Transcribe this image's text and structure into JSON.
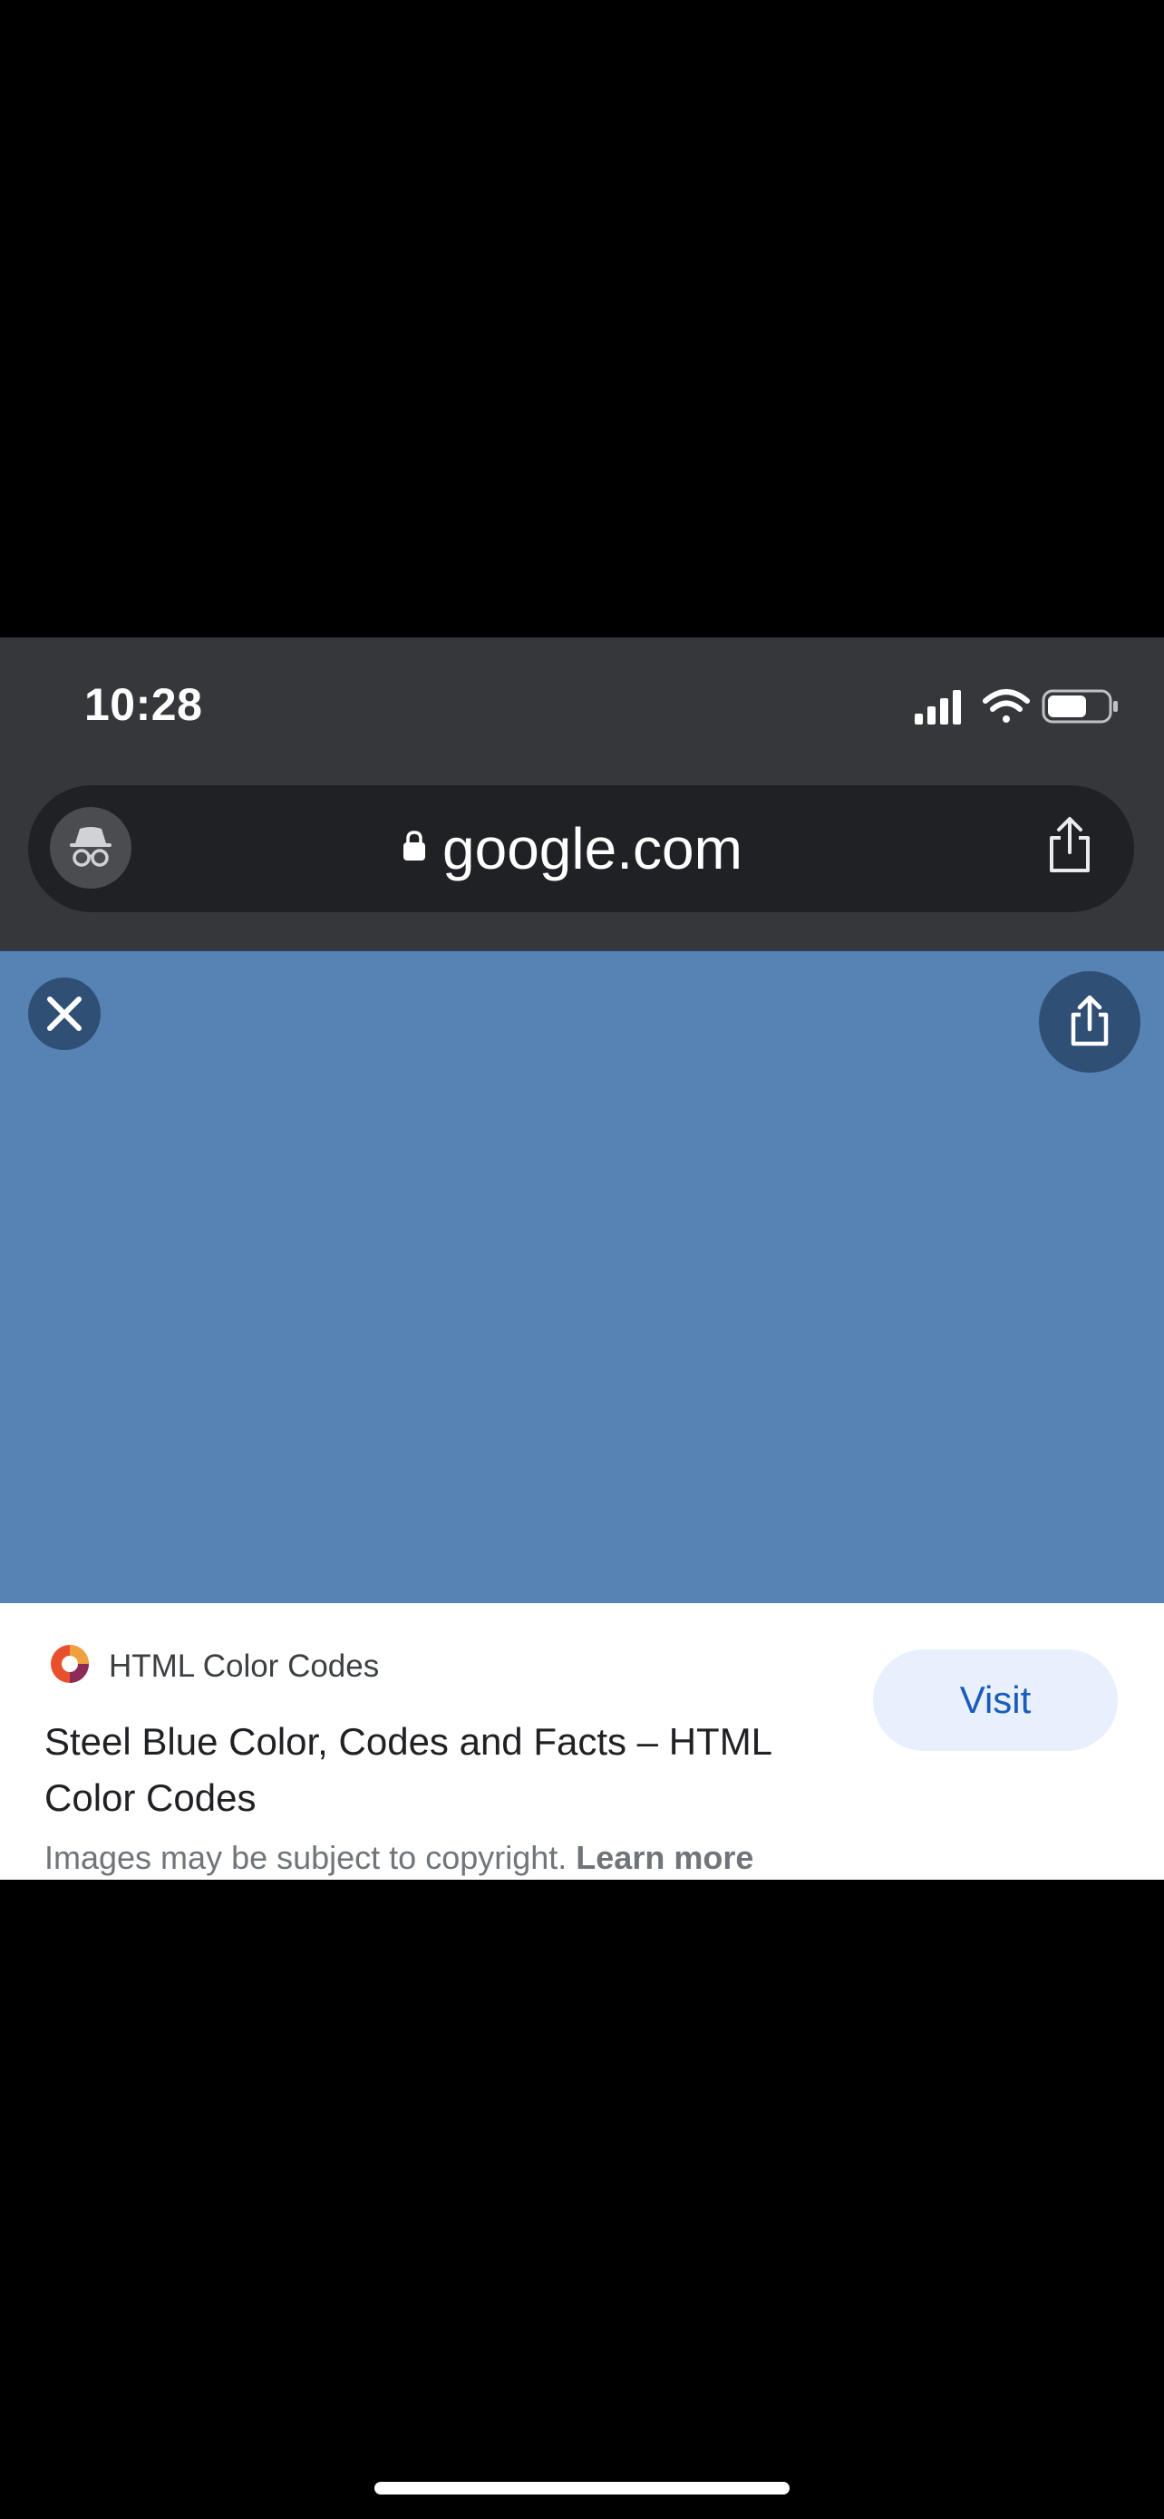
{
  "status_bar": {
    "time": "10:28",
    "icons": [
      "signal-icon",
      "wifi-icon",
      "battery-icon"
    ]
  },
  "browser": {
    "mode_icon": "incognito-icon",
    "url": "google.com",
    "url_icon": "lock-icon",
    "share_icon": "share-icon"
  },
  "viewer": {
    "image_color": "#5682b4",
    "close_icon": "close-icon",
    "share_icon": "share-icon"
  },
  "result": {
    "site_name": "HTML Color Codes",
    "title": "Steel Blue Color, Codes and Facts – HTML Color Codes",
    "visit_label": "Visit",
    "copyright_text": "Images may be subject to copyright.",
    "learn_more": "Learn more"
  }
}
